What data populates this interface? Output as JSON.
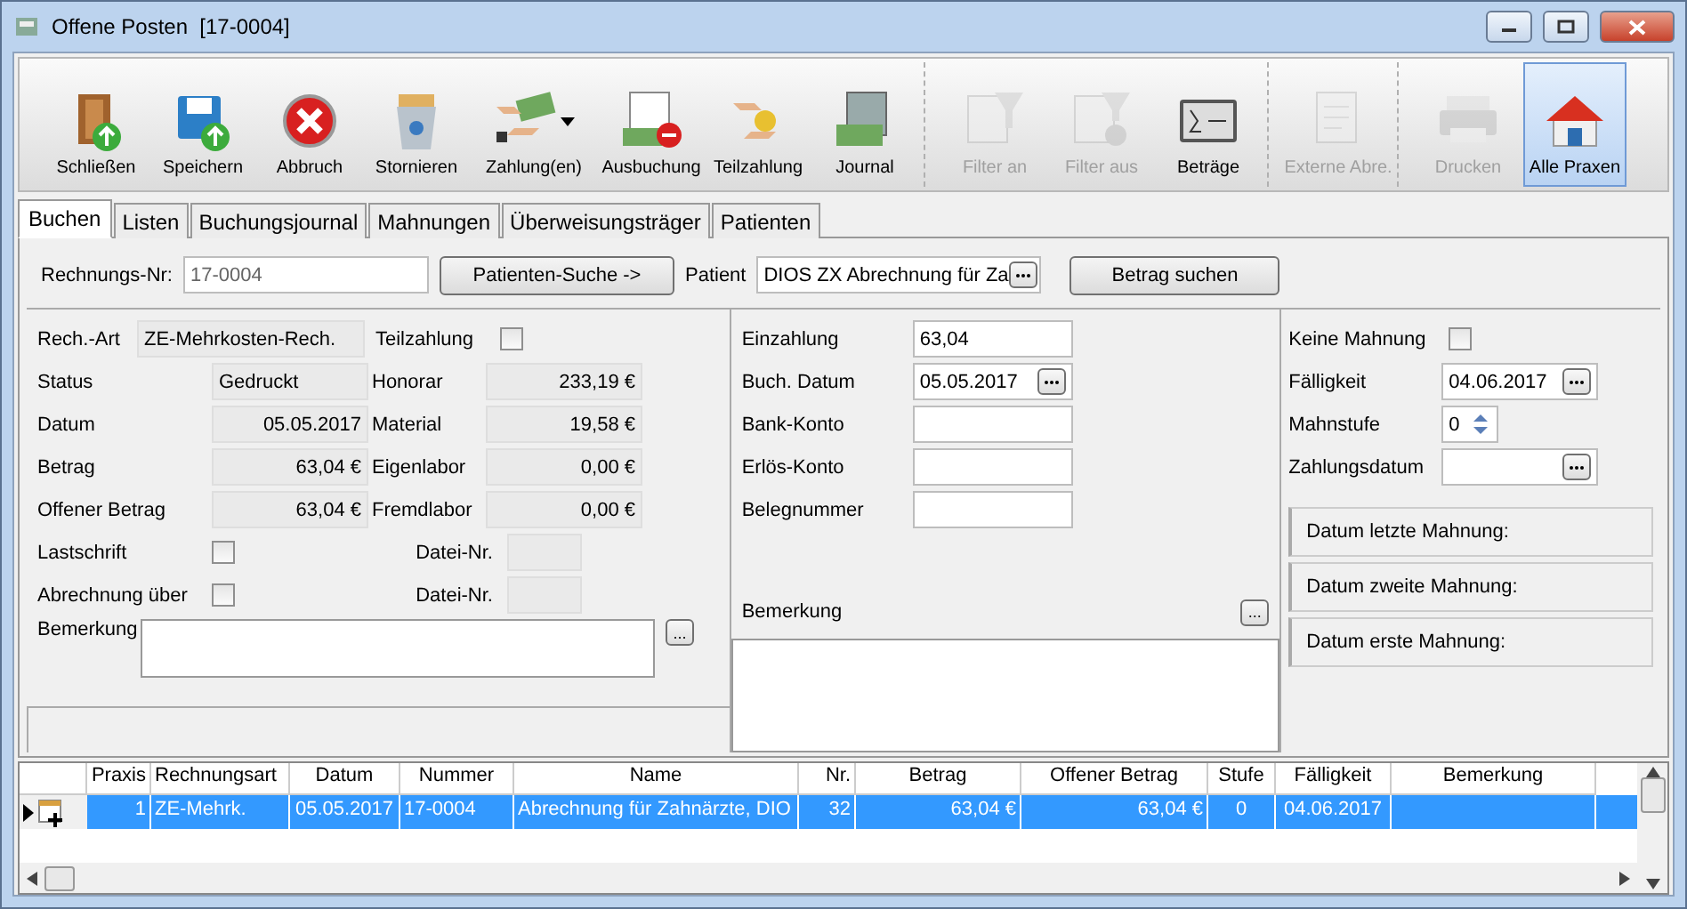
{
  "window": {
    "title": "Offene Posten  [17-0004]"
  },
  "toolbar": {
    "groups": [
      {
        "buttons": [
          {
            "label": "Schließen",
            "disabled": false,
            "pressed": false,
            "dropdown": false
          },
          {
            "label": "Speichern",
            "disabled": false,
            "pressed": false,
            "dropdown": false
          },
          {
            "label": "Abbruch",
            "disabled": false,
            "pressed": false,
            "dropdown": false
          },
          {
            "label": "Stornieren",
            "disabled": false,
            "pressed": false,
            "dropdown": false
          },
          {
            "label": "Zahlung(en)",
            "disabled": false,
            "pressed": false,
            "dropdown": true
          },
          {
            "label": "Ausbuchung",
            "disabled": false,
            "pressed": false,
            "dropdown": false
          },
          {
            "label": "Teilzahlung",
            "disabled": false,
            "pressed": false,
            "dropdown": false
          },
          {
            "label": "Journal",
            "disabled": false,
            "pressed": false,
            "dropdown": false
          }
        ]
      },
      {
        "buttons": [
          {
            "label": "Filter an",
            "disabled": true,
            "pressed": false,
            "dropdown": false
          },
          {
            "label": "Filter aus",
            "disabled": true,
            "pressed": false,
            "dropdown": false
          },
          {
            "label": "Beträge",
            "disabled": false,
            "pressed": false,
            "dropdown": false
          }
        ]
      },
      {
        "buttons": [
          {
            "label": "Externe Abre.",
            "disabled": true,
            "pressed": false,
            "dropdown": false
          }
        ]
      },
      {
        "buttons": [
          {
            "label": "Drucken",
            "disabled": true,
            "pressed": false,
            "dropdown": false
          },
          {
            "label": "Alle Praxen",
            "disabled": false,
            "pressed": true,
            "dropdown": false
          }
        ]
      }
    ]
  },
  "tabs": [
    {
      "label": "Buchen",
      "selected": true
    },
    {
      "label": "Listen",
      "selected": false
    },
    {
      "label": "Buchungsjournal",
      "selected": false
    },
    {
      "label": "Mahnungen",
      "selected": false
    },
    {
      "label": "Überweisungsträger",
      "selected": false
    },
    {
      "label": "Patienten",
      "selected": false
    }
  ],
  "header": {
    "invoice_label": "Rechnungs-Nr:",
    "invoice_value": "17-0004",
    "patient_search": "Patienten-Suche ->",
    "patient_label": "Patient",
    "patient_value": "DIOS ZX Abrechnung für Za",
    "amount_search": "Betrag suchen"
  },
  "invoice": {
    "type_label": "Rech.-Art",
    "type_value": "ZE-Mehrkosten-Rech.",
    "partial_label": "Teilzahlung",
    "partial_checked": false,
    "left_rows": [
      {
        "label": "Status",
        "value": "Gedruckt"
      },
      {
        "label": "Datum",
        "value": "05.05.2017"
      },
      {
        "label": "Betrag",
        "value": "63,04 €"
      },
      {
        "label": "Offener Betrag",
        "value": "63,04 €"
      }
    ],
    "right_rows": [
      {
        "label": "Honorar",
        "value": "233,19 €"
      },
      {
        "label": "Material",
        "value": "19,58 €"
      },
      {
        "label": "Eigenlabor",
        "value": "0,00 €"
      },
      {
        "label": "Fremdlabor",
        "value": "0,00 €"
      }
    ],
    "checks": [
      {
        "label": "Lastschrift",
        "checked": false,
        "file_label": "Datei-Nr."
      },
      {
        "label": "Abrechnung über",
        "checked": false,
        "file_label": "Datei-Nr."
      }
    ],
    "remark_label": "Bemerkung",
    "remark_button": "..."
  },
  "payment": {
    "fields": [
      {
        "label": "Einzahlung",
        "value": "63,04",
        "picker": false
      },
      {
        "label": "Buch. Datum",
        "value": "05.05.2017",
        "picker": true
      },
      {
        "label": "Bank-Konto",
        "picker": false
      },
      {
        "label": "Erlös-Konto",
        "picker": false
      },
      {
        "label": "Belegnummer",
        "picker": false
      }
    ],
    "remark_label": "Bemerkung",
    "remark_button": "..."
  },
  "dunning": {
    "none_label": "Keine Mahnung",
    "none_checked": false,
    "due_label": "Fälligkeit",
    "due_value": "04.06.2017",
    "level_label": "Mahnstufe",
    "level_value": "0",
    "paydate_label": "Zahlungsdatum",
    "dates": [
      "Datum letzte Mahnung:",
      "Datum zweite Mahnung:",
      "Datum erste Mahnung:"
    ]
  },
  "table": {
    "columns": [
      "Praxis",
      "Rechnungsart",
      "Datum",
      "Nummer",
      "Name",
      "Nr.",
      "Betrag",
      "Offener Betrag",
      "Stufe",
      "Fälligkeit",
      "Bemerkung"
    ],
    "rows": [
      {
        "selected": true,
        "current": true,
        "cells": [
          "1",
          "ZE-Mehrk.",
          "05.05.2017",
          "17-0004",
          "Abrechnung für Zahnärzte, DIO",
          "32",
          "63,04 €",
          "63,04 €",
          "0",
          "04.06.2017",
          ""
        ]
      }
    ]
  }
}
